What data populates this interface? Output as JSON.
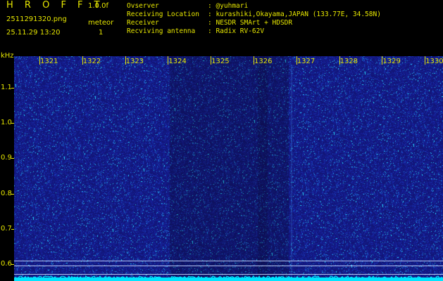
{
  "header": {
    "brand": "H R O F F T",
    "version": "1.0.0f",
    "filename": "2511291320.png",
    "timestamp": "25.11.29 13:20",
    "meteor_label": "meteor",
    "meteor_count": "1"
  },
  "info": [
    {
      "key": "Ovserver",
      "value": ": @yuhmari"
    },
    {
      "key": "Receiving Location",
      "value": ": kurashiki,Okayama,JAPAN (133.77E, 34.58N)"
    },
    {
      "key": "Receiver",
      "value": ": NESDR SMArt + HDSDR"
    },
    {
      "key": "Recviving antenna",
      "value": ": Radix RV-62V"
    }
  ],
  "y_axis": {
    "unit": "kHz",
    "ticks": [
      "1.1",
      "1.0",
      "0.9",
      "0.8",
      "0.7",
      "0.6"
    ]
  },
  "x_axis": {
    "ticks": [
      "1321",
      "1322",
      "1323",
      "1324",
      "1325",
      "1326",
      "1327",
      "1328",
      "1329",
      "1330"
    ]
  },
  "colors": {
    "text": "#e6e600",
    "background": "#1b1f8e",
    "trace": "#00e5ff",
    "marker_line": "#c8d8ff"
  }
}
